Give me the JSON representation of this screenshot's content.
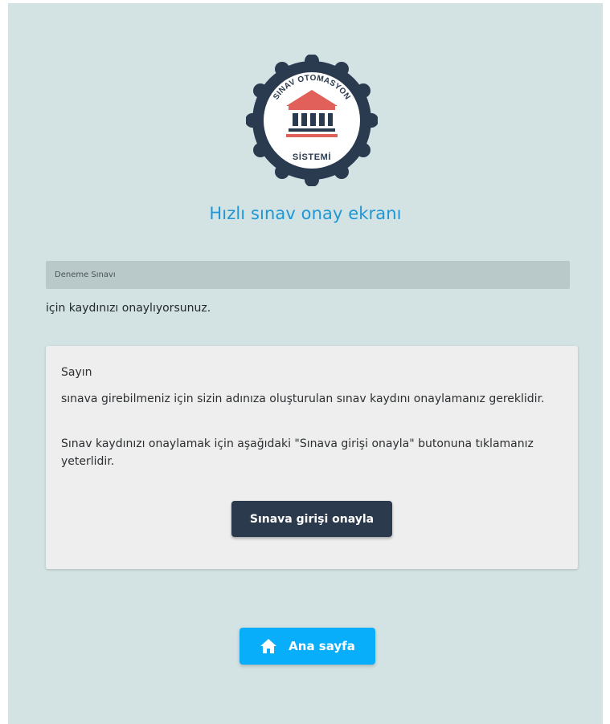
{
  "logo": {
    "top_text": "SINAV OTOMASYON",
    "bottom_text": "SİSTEMİ"
  },
  "page": {
    "title": "Hızlı sınav onay ekranı"
  },
  "exam": {
    "name": "Deneme Sınavı",
    "confirm_text": "için kaydınızı onaylıyorsunuz."
  },
  "info": {
    "greeting": "Sayın",
    "paragraph1": "sınava girebilmeniz için sizin adınıza oluşturulan sınav kaydını onaylamanız gereklidir.",
    "paragraph2": "Sınav kaydınızı onaylamak için aşağıdaki \"Sınava girişi onayla\" butonuna tıklamanız yeterlidir."
  },
  "buttons": {
    "confirm_label": "Sınava girişi onayla",
    "home_label": "Ana sayfa",
    "home_icon": "home-icon"
  },
  "colors": {
    "background": "#d3e2e2",
    "title": "#1e97d6",
    "confirm_button": "#2c3a4d",
    "home_button": "#09aefa",
    "logo_ring": "#2a3a4f",
    "logo_accent": "#e2605a"
  }
}
